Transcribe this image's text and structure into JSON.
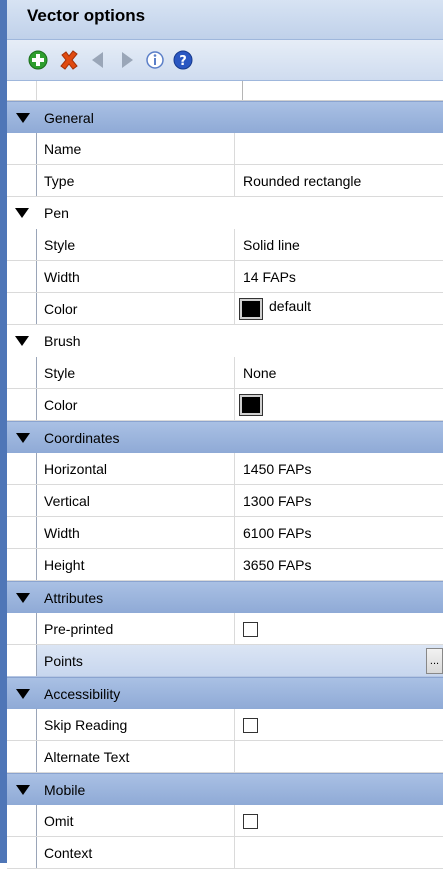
{
  "window": {
    "title": "Vector options"
  },
  "toolbar": {
    "buttons": [
      {
        "name": "add-icon",
        "color": "#2e9e2e"
      },
      {
        "name": "delete-icon",
        "color": "#e04a10"
      },
      {
        "name": "previous-icon",
        "color": "#9aa6b8"
      },
      {
        "name": "next-icon",
        "color": "#9aa6b8"
      },
      {
        "name": "info-icon",
        "color": "#5b7fc8"
      },
      {
        "name": "help-icon",
        "color": "#2a57c2"
      }
    ]
  },
  "sections": {
    "general": {
      "label": "General"
    },
    "pen": {
      "label": "Pen"
    },
    "brush": {
      "label": "Brush"
    },
    "coordinates": {
      "label": "Coordinates"
    },
    "attributes": {
      "label": "Attributes"
    },
    "accessibility": {
      "label": "Accessibility"
    },
    "mobile": {
      "label": "Mobile"
    }
  },
  "props": {
    "name": {
      "label": "Name",
      "value": ""
    },
    "type": {
      "label": "Type",
      "value": "Rounded rectangle"
    },
    "pen_style": {
      "label": "Style",
      "value": "Solid line"
    },
    "pen_width": {
      "label": "Width",
      "value": "14 FAPs"
    },
    "pen_color": {
      "label": "Color",
      "value": "default",
      "swatch": "#000000"
    },
    "brush_style": {
      "label": "Style",
      "value": "None"
    },
    "brush_color": {
      "label": "Color",
      "swatch": "#000000"
    },
    "horizontal": {
      "label": "Horizontal",
      "value": "1450 FAPs"
    },
    "vertical": {
      "label": "Vertical",
      "value": "1300 FAPs"
    },
    "width": {
      "label": "Width",
      "value": "6100 FAPs"
    },
    "height": {
      "label": "Height",
      "value": "3650 FAPs"
    },
    "preprinted": {
      "label": "Pre-printed",
      "checked": false
    },
    "points": {
      "label": "Points",
      "button": "..."
    },
    "skip_reading": {
      "label": "Skip Reading",
      "checked": false
    },
    "alternate_text": {
      "label": "Alternate Text",
      "value": ""
    },
    "omit": {
      "label": "Omit",
      "checked": false
    },
    "context": {
      "label": "Context",
      "value": ""
    }
  },
  "colors": {
    "section_bg": "#9fb8df",
    "border": "#4f76b7"
  }
}
